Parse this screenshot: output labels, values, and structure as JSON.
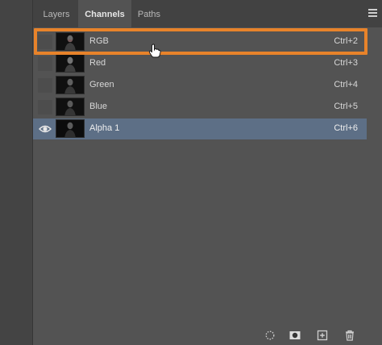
{
  "tabs": [
    {
      "label": "Layers",
      "active": false
    },
    {
      "label": "Channels",
      "active": true
    },
    {
      "label": "Paths",
      "active": false
    }
  ],
  "channels": [
    {
      "name": "RGB",
      "shortcut": "Ctrl+2",
      "visible": false,
      "selected": false
    },
    {
      "name": "Red",
      "shortcut": "Ctrl+3",
      "visible": false,
      "selected": false
    },
    {
      "name": "Green",
      "shortcut": "Ctrl+4",
      "visible": false,
      "selected": false
    },
    {
      "name": "Blue",
      "shortcut": "Ctrl+5",
      "visible": false,
      "selected": false
    },
    {
      "name": "Alpha 1",
      "shortcut": "Ctrl+6",
      "visible": true,
      "selected": true
    }
  ],
  "colors": {
    "highlight": "#e8832a",
    "selection": "#5d6f86",
    "panel": "#535353"
  },
  "icons": {
    "panel_menu": "hamburger-icon",
    "visibility": "eye-icon",
    "bottom": [
      "load-selection-icon",
      "save-selection-icon",
      "new-channel-icon",
      "delete-channel-icon"
    ]
  }
}
